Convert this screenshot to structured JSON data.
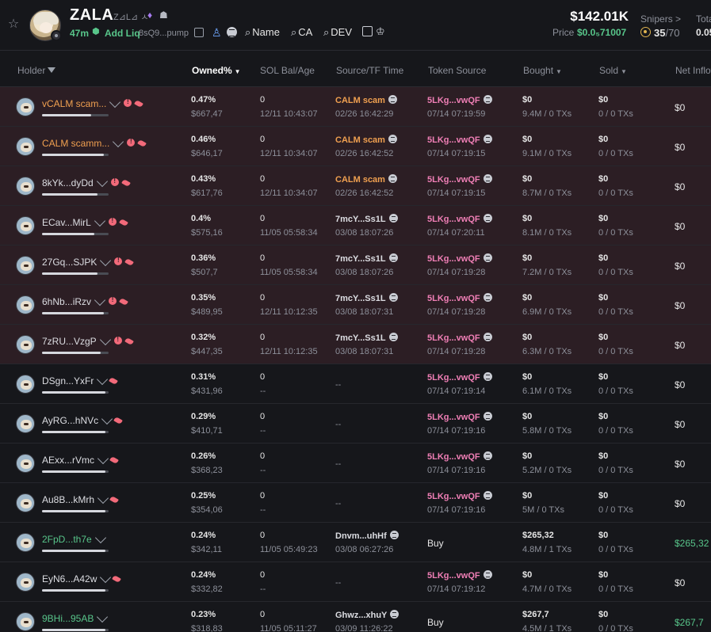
{
  "header": {
    "ticker": "ZALA",
    "name": "Z⊿L⊿ ㅅ",
    "age": "47m",
    "add_liq": "Add Liq",
    "contract": "8sQ9...pump",
    "search_name": "Name",
    "search_ca": "CA",
    "search_dev": "DEV",
    "market_cap": "$142.01K",
    "price_label": "Price",
    "price_value": "$0.0₅71007",
    "snipers_label": "Snipers >",
    "snipers_value": "35",
    "snipers_total": "/70",
    "total_label": "Tota",
    "total_value": "0.05"
  },
  "columns": {
    "holder": "Holder",
    "owned": "Owned%",
    "sol_bal": "SOL Bal/Age",
    "source_tf": "Source/TF Time",
    "token_source": "Token Source",
    "bought": "Bought",
    "sold": "Sold",
    "net_inflow": "Net Inflow"
  },
  "colors": {
    "green": "#58c58a",
    "orange": "#f0a050",
    "pink": "#f07fb6",
    "red": "#f26a7a",
    "flag_bg": "#2c1e24"
  },
  "rows": [
    {
      "name": "vCALM scam...",
      "pct": "0.47%",
      "usd": "$667,47",
      "bal": "0",
      "ts1": "12/11 10:43:07",
      "src": "CALM scam",
      "ts2": "02/26 16:42:29",
      "tsrc": "5LKg...vwQF",
      "tsrc_time": "07/14 07:19:59",
      "bought": "$0",
      "bought_sub": "9.4M / 0 TXs",
      "sold": "$0",
      "sold_sub": "0 / 0 TXs",
      "net": "$0"
    },
    {
      "name": "CALM scamm...",
      "pct": "0.46%",
      "usd": "$646,17",
      "bal": "0",
      "ts1": "12/11 10:34:07",
      "src": "CALM scam",
      "ts2": "02/26 16:42:52",
      "tsrc": "5LKg...vwQF",
      "tsrc_time": "07/14 07:19:15",
      "bought": "$0",
      "bought_sub": "9.1M / 0 TXs",
      "sold": "$0",
      "sold_sub": "0 / 0 TXs",
      "net": "$0"
    },
    {
      "name": "8kYk...dyDd",
      "pct": "0.43%",
      "usd": "$617,76",
      "bal": "0",
      "ts1": "12/11 10:34:07",
      "src": "CALM scam",
      "ts2": "02/26 16:42:52",
      "tsrc": "5LKg...vwQF",
      "tsrc_time": "07/14 07:19:15",
      "bought": "$0",
      "bought_sub": "8.7M / 0 TXs",
      "sold": "$0",
      "sold_sub": "0 / 0 TXs",
      "net": "$0"
    },
    {
      "name": "ECav...MirL",
      "pct": "0.4%",
      "usd": "$575,16",
      "bal": "0",
      "ts1": "11/05 05:58:34",
      "src": "7mcY...Ss1L",
      "ts2": "03/08 18:07:26",
      "tsrc": "5LKg...vwQF",
      "tsrc_time": "07/14 07:20:11",
      "bought": "$0",
      "bought_sub": "8.1M / 0 TXs",
      "sold": "$0",
      "sold_sub": "0 / 0 TXs",
      "net": "$0"
    },
    {
      "name": "27Gq...SJPK",
      "pct": "0.36%",
      "usd": "$507,7",
      "bal": "0",
      "ts1": "11/05 05:58:34",
      "src": "7mcY...Ss1L",
      "ts2": "03/08 18:07:26",
      "tsrc": "5LKg...vwQF",
      "tsrc_time": "07/14 07:19:28",
      "bought": "$0",
      "bought_sub": "7.2M / 0 TXs",
      "sold": "$0",
      "sold_sub": "0 / 0 TXs",
      "net": "$0"
    },
    {
      "name": "6hNb...iRzv",
      "pct": "0.35%",
      "usd": "$489,95",
      "bal": "0",
      "ts1": "12/11 10:12:35",
      "src": "7mcY...Ss1L",
      "ts2": "03/08 18:07:31",
      "tsrc": "5LKg...vwQF",
      "tsrc_time": "07/14 07:19:28",
      "bought": "$0",
      "bought_sub": "6.9M / 0 TXs",
      "sold": "$0",
      "sold_sub": "0 / 0 TXs",
      "net": "$0"
    },
    {
      "name": "7zRU...VzgP",
      "pct": "0.32%",
      "usd": "$447,35",
      "bal": "0",
      "ts1": "12/11 10:12:35",
      "src": "7mcY...Ss1L",
      "ts2": "03/08 18:07:31",
      "tsrc": "5LKg...vwQF",
      "tsrc_time": "07/14 07:19:28",
      "bought": "$0",
      "bought_sub": "6.3M / 0 TXs",
      "sold": "$0",
      "sold_sub": "0 / 0 TXs",
      "net": "$0"
    },
    {
      "name": "DSgn...YxFr",
      "pct": "0.31%",
      "usd": "$431,96",
      "bal": "0",
      "ts1": "--",
      "src": "--",
      "ts2": "",
      "tsrc": "5LKg...vwQF",
      "tsrc_time": "07/14 07:19:14",
      "bought": "$0",
      "bought_sub": "6.1M / 0 TXs",
      "sold": "$0",
      "sold_sub": "0 / 0 TXs",
      "net": "$0"
    },
    {
      "name": "AyRG...hNVc",
      "pct": "0.29%",
      "usd": "$410,71",
      "bal": "0",
      "ts1": "--",
      "src": "--",
      "ts2": "",
      "tsrc": "5LKg...vwQF",
      "tsrc_time": "07/14 07:19:16",
      "bought": "$0",
      "bought_sub": "5.8M / 0 TXs",
      "sold": "$0",
      "sold_sub": "0 / 0 TXs",
      "net": "$0"
    },
    {
      "name": "AExx...rVmc",
      "pct": "0.26%",
      "usd": "$368,23",
      "bal": "0",
      "ts1": "--",
      "src": "--",
      "ts2": "",
      "tsrc": "5LKg...vwQF",
      "tsrc_time": "07/14 07:19:16",
      "bought": "$0",
      "bought_sub": "5.2M / 0 TXs",
      "sold": "$0",
      "sold_sub": "0 / 0 TXs",
      "net": "$0"
    },
    {
      "name": "Au8B...kMrh",
      "pct": "0.25%",
      "usd": "$354,06",
      "bal": "0",
      "ts1": "--",
      "src": "--",
      "ts2": "",
      "tsrc": "5LKg...vwQF",
      "tsrc_time": "07/14 07:19:16",
      "bought": "$0",
      "bought_sub": "5M / 0 TXs",
      "sold": "$0",
      "sold_sub": "0 / 0 TXs",
      "net": "$0"
    },
    {
      "name": "2FpD...th7e",
      "pct": "0.24%",
      "usd": "$342,11",
      "bal": "0",
      "ts1": "11/05 05:49:23",
      "src": "Dnvm...uhHf",
      "ts2": "03/08 06:27:26",
      "tsrc": "Buy",
      "tsrc_time": "",
      "bought": "$265,32",
      "bought_sub": "4.8M / 1 TXs",
      "sold": "$0",
      "sold_sub": "0 / 0 TXs",
      "net": "$265,32"
    },
    {
      "name": "EyN6...A42w",
      "pct": "0.24%",
      "usd": "$332,82",
      "bal": "0",
      "ts1": "--",
      "src": "--",
      "ts2": "",
      "tsrc": "5LKg...vwQF",
      "tsrc_time": "07/14 07:19:12",
      "bought": "$0",
      "bought_sub": "4.7M / 0 TXs",
      "sold": "$0",
      "sold_sub": "0 / 0 TXs",
      "net": "$0"
    },
    {
      "name": "9BHi...95AB",
      "pct": "0.23%",
      "usd": "$318,83",
      "bal": "0",
      "ts1": "11/05 05:11:27",
      "src": "Ghwz...xhuY",
      "ts2": "03/09 11:26:22",
      "tsrc": "Buy",
      "tsrc_time": "",
      "bought": "$267,7",
      "bought_sub": "4.5M / 1 TXs",
      "sold": "$0",
      "sold_sub": "0 / 0 TXs",
      "net": "$267,7"
    }
  ]
}
